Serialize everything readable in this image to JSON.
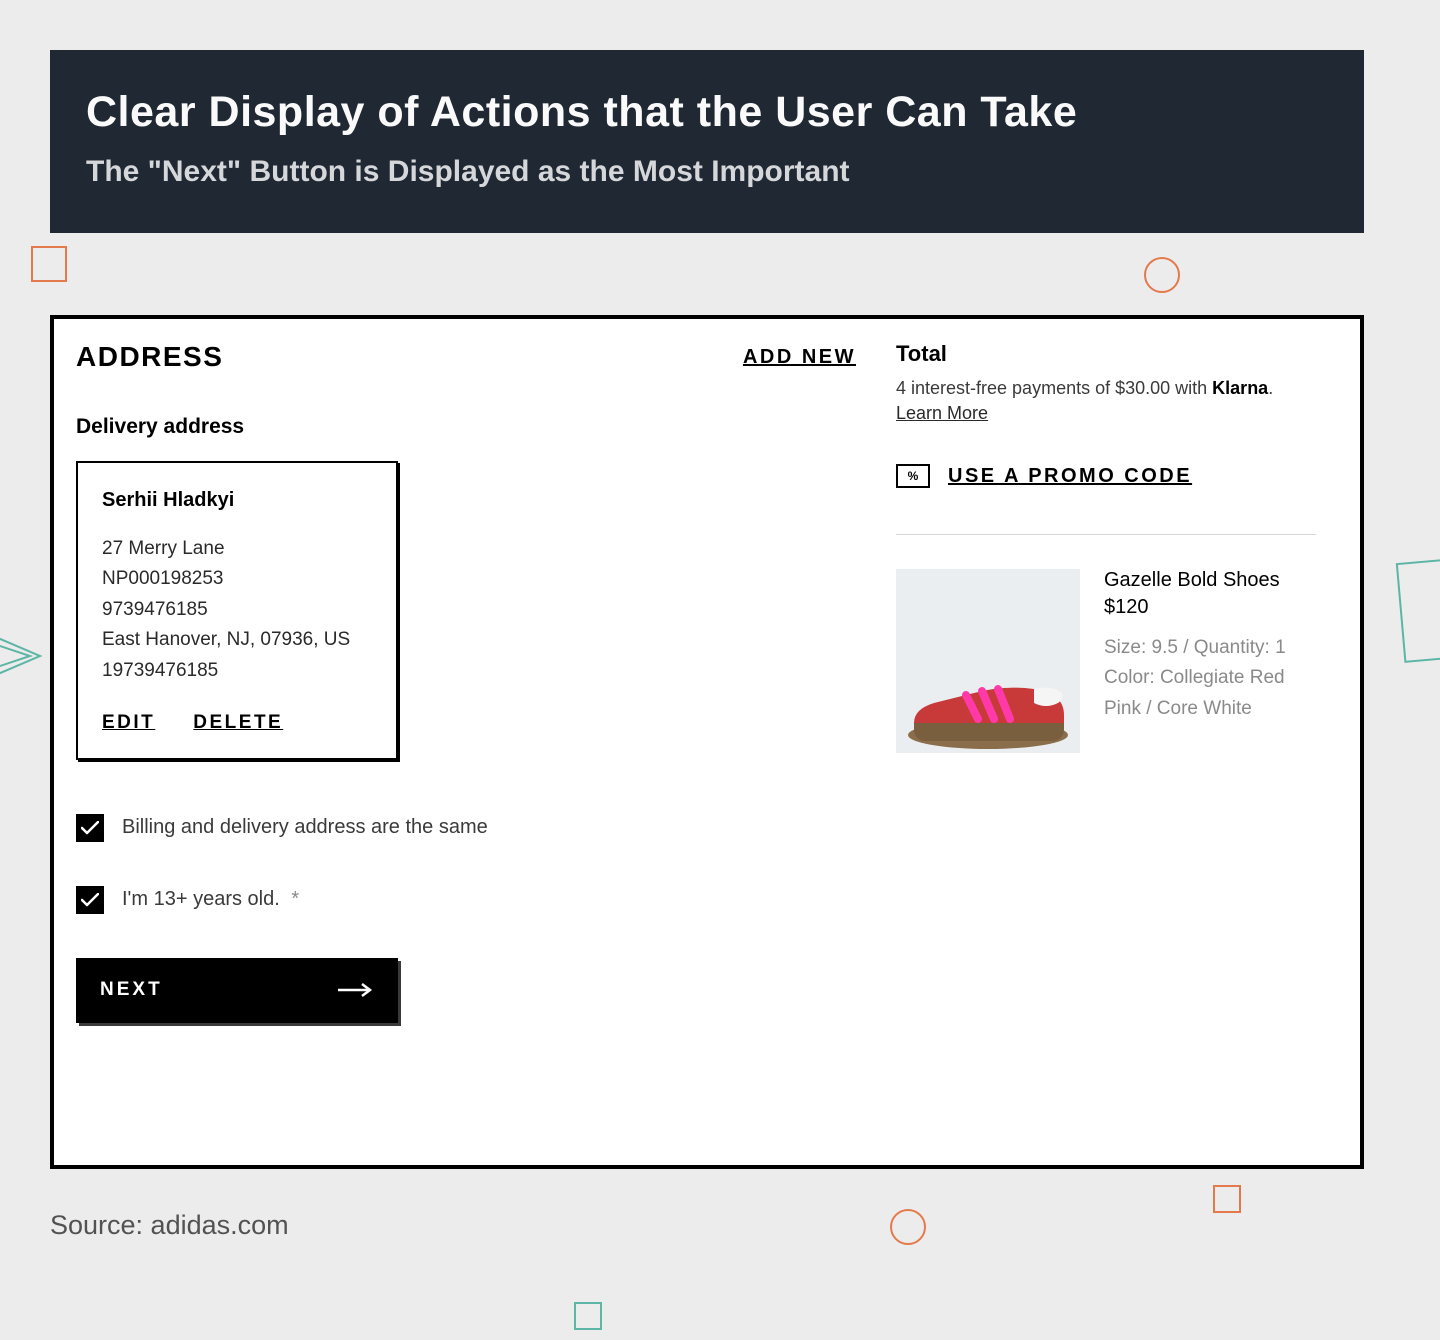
{
  "header": {
    "title": "Clear Display of Actions that the User Can Take",
    "subtitle": "The \"Next\" Button is Displayed as the Most Important"
  },
  "checkout": {
    "address_section_title": "ADDRESS",
    "add_new_label": "ADD NEW",
    "delivery_label": "Delivery address",
    "address": {
      "name": "Serhii Hladkyi",
      "line1": "27 Merry Lane",
      "line2": "NP000198253",
      "line3": "9739476185",
      "line4": "East Hanover, NJ, 07936, US",
      "line5": "19739476185"
    },
    "edit_label": "EDIT",
    "delete_label": "DELETE",
    "checkbox1_label": "Billing and delivery address are the same",
    "checkbox2_label": "I'm 13+ years old.",
    "checkbox2_required": "*",
    "next_label": "NEXT"
  },
  "summary": {
    "total_label": "Total",
    "klarna_text_prefix": "4 interest-free payments of $30.00 with ",
    "klarna_brand": "Klarna",
    "klarna_text_suffix": ".",
    "learn_more": "Learn More",
    "promo_icon_text": "%",
    "promo_label": "USE A PROMO CODE",
    "product": {
      "name": "Gazelle Bold Shoes",
      "price": "$120",
      "size_qty": "Size: 9.5 / Quantity: 1",
      "color": "Color: Collegiate Red Pink / Core White"
    }
  },
  "source": "Source: adidas.com"
}
